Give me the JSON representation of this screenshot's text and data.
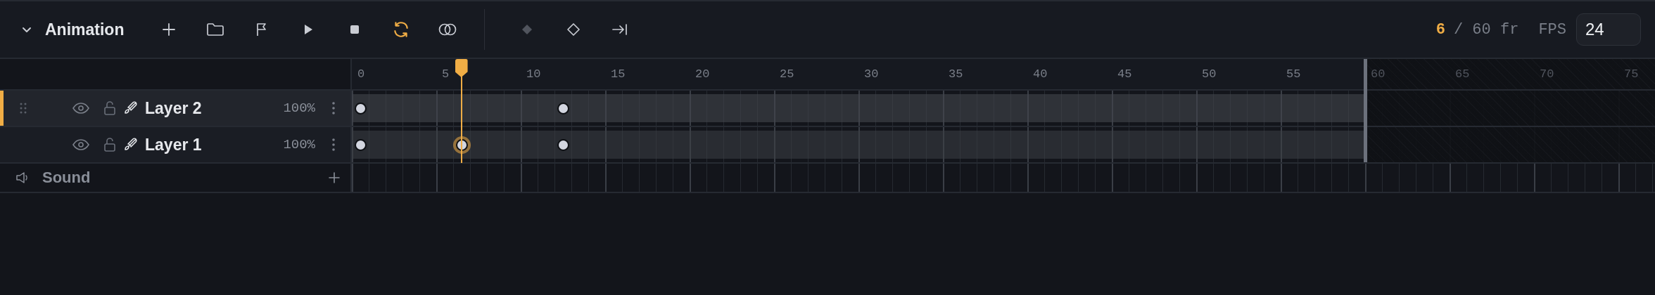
{
  "panel": {
    "title": "Animation",
    "expanded": true
  },
  "tools": [
    {
      "kind": "add",
      "active": false,
      "disabled": false
    },
    {
      "kind": "folder",
      "active": false,
      "disabled": false
    },
    {
      "kind": "flag",
      "active": false,
      "disabled": false
    },
    {
      "kind": "play",
      "active": false,
      "disabled": false
    },
    {
      "kind": "stop",
      "active": false,
      "disabled": false
    },
    {
      "kind": "loop",
      "active": true,
      "disabled": false
    },
    {
      "kind": "onion",
      "active": false,
      "disabled": false
    },
    {
      "kind": "keyframe-filled",
      "active": false,
      "disabled": true
    },
    {
      "kind": "keyframe-empty",
      "active": false,
      "disabled": false
    },
    {
      "kind": "go-end",
      "active": false,
      "disabled": false
    }
  ],
  "counter": {
    "current": "6",
    "total": "/ 60 fr"
  },
  "fps": {
    "label": "FPS",
    "value": "24"
  },
  "ruler": {
    "labels": [
      "0",
      "5",
      "10",
      "15",
      "20",
      "25",
      "30",
      "35",
      "40",
      "45",
      "50",
      "55",
      "60",
      "65",
      "70",
      "75"
    ],
    "playhead": {
      "level": 0.084
    },
    "end_marker": {
      "level": 0.75
    }
  },
  "layers": [
    {
      "name": "Layer 2",
      "opacity": "100%",
      "visible": true,
      "locked": false,
      "selected": true,
      "keyframes": [
        {
          "level": 0,
          "selected": false
        },
        {
          "level": 0.15,
          "selected": false
        }
      ]
    },
    {
      "name": "Layer 1",
      "opacity": "100%",
      "visible": true,
      "locked": false,
      "selected": false,
      "keyframes": [
        {
          "level": 0,
          "selected": false
        },
        {
          "level": 0.075,
          "selected": true
        },
        {
          "level": 0.15,
          "selected": false
        }
      ]
    }
  ],
  "sound": {
    "label": "Sound"
  }
}
